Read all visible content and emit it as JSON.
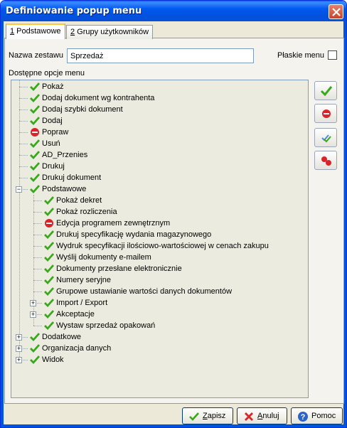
{
  "window": {
    "title": "Definiowanie popup menu"
  },
  "tabs": [
    {
      "key": "1",
      "label": " Podstawowe"
    },
    {
      "key": "2",
      "label": " Grupy użytkowników"
    }
  ],
  "form": {
    "name_label": "Nazwa zestawu",
    "name_value": "Sprzedaż",
    "flat_label": "Płaskie menu",
    "flat_checked": false,
    "options_label": "Dostępne opcje menu"
  },
  "tree": [
    {
      "label": "Pokaż",
      "status": "ok"
    },
    {
      "label": "Dodaj dokument wg kontrahenta",
      "status": "ok"
    },
    {
      "label": "Dodaj szybki dokument",
      "status": "ok"
    },
    {
      "label": "Dodaj",
      "status": "ok"
    },
    {
      "label": "Popraw",
      "status": "no"
    },
    {
      "label": "Usuń",
      "status": "ok"
    },
    {
      "label": "AD_Przenies",
      "status": "ok"
    },
    {
      "label": "Drukuj",
      "status": "ok"
    },
    {
      "label": "Drukuj dokument",
      "status": "ok"
    },
    {
      "label": "Podstawowe",
      "status": "ok",
      "expander": "minus"
    },
    {
      "label": "Pokaż dekret",
      "status": "ok"
    },
    {
      "label": "Pokaż rozliczenia",
      "status": "ok"
    },
    {
      "label": "Edycja programem zewnętrznym",
      "status": "no"
    },
    {
      "label": "Drukuj specyfikację wydania magazynowego",
      "status": "ok"
    },
    {
      "label": "Wydruk specyfikacji ilościowo-wartościowej w cenach zakupu",
      "status": "ok"
    },
    {
      "label": "Wyślij dokumenty e-mailem",
      "status": "ok"
    },
    {
      "label": "Dokumenty przesłane elektronicznie",
      "status": "ok"
    },
    {
      "label": "Numery seryjne",
      "status": "ok"
    },
    {
      "label": "Grupowe ustawianie wartości danych dokumentów",
      "status": "ok"
    },
    {
      "label": "Import / Export",
      "status": "ok",
      "expander": "plus"
    },
    {
      "label": "Akceptacje",
      "status": "ok",
      "expander": "plus"
    },
    {
      "label": "Wystaw sprzedaż opakowań",
      "status": "ok"
    },
    {
      "label": "Dodatkowe",
      "status": "ok",
      "expander": "plus"
    },
    {
      "label": "Organizacja danych",
      "status": "ok",
      "expander": "plus"
    },
    {
      "label": "Widok",
      "status": "ok",
      "expander": "plus"
    }
  ],
  "side_buttons": [
    "check-icon",
    "minus-circle-icon",
    "multi-check-icon",
    "multi-minus-icon"
  ],
  "buttons": {
    "save": {
      "key": "Z",
      "rest": "apisz"
    },
    "cancel": {
      "key": "A",
      "rest": "nuluj"
    },
    "help": {
      "label": "Pomoc"
    }
  },
  "colors": {
    "ok": "#3aa81c",
    "no": "#d9242a",
    "titlebar": "#0054e3"
  }
}
